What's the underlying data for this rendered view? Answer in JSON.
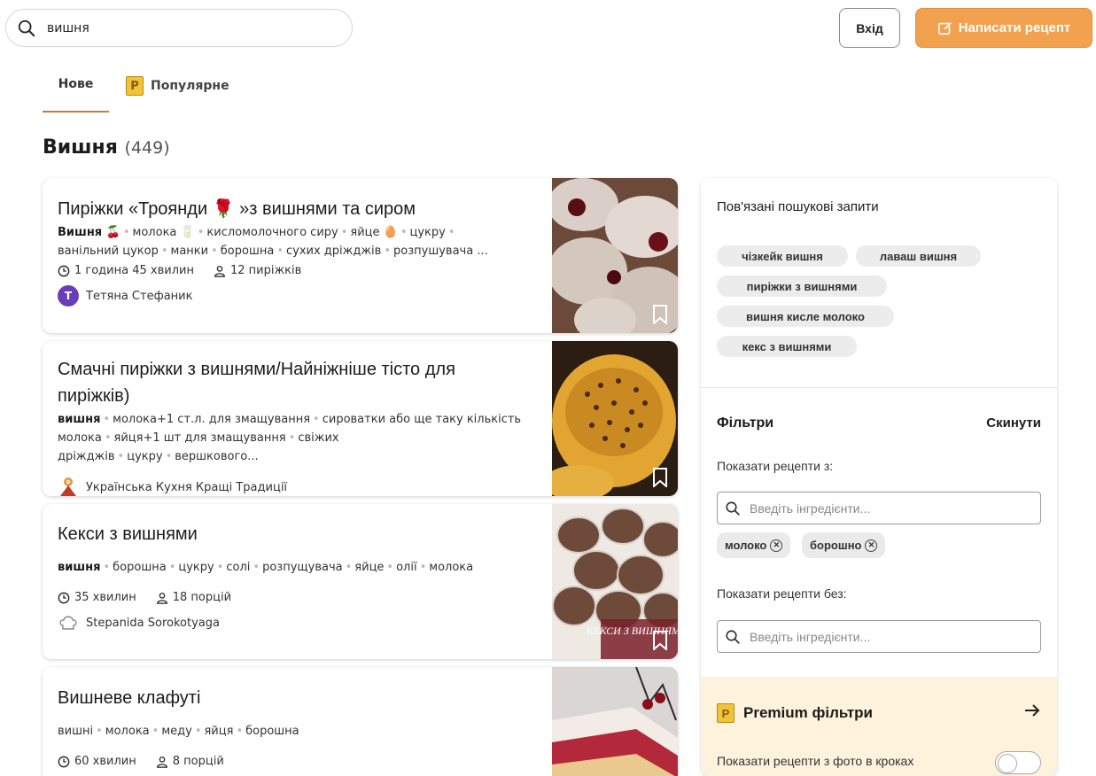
{
  "search": {
    "value": "вишня"
  },
  "header": {
    "login_label": "Вхід",
    "write_label": "Написати рецепт"
  },
  "tabs": [
    {
      "label": "Нове"
    },
    {
      "label": "Популярне"
    }
  ],
  "heading": {
    "title": "Вишня",
    "count": "(449)"
  },
  "recipes": [
    {
      "title": "Пиріжки «Троянди 🌹 »з вишнями та сиром",
      "ingredients_line1": [
        "Вишня 🍒",
        "молока 🥛",
        "кисломолочного сиру",
        "яйце 🥚",
        "цукру"
      ],
      "ingredients_line2": [
        "ванільний цукор",
        "манки",
        "борошна",
        "сухих дріжджів",
        "розпушувача ..."
      ],
      "time": "1 година 45 хвилин",
      "servings": "12 пиріжків",
      "author": "Тетяна Стефаник",
      "author_initial": "T"
    },
    {
      "title": "Смачні пиріжки з вишнями/Найніжніше тісто для пиріжків)",
      "ingredients_line1": [
        "вишня",
        "молока+1 ст.л. для змащування",
        "сироватки або ще таку кількість"
      ],
      "ingredients_line2": [
        "молока",
        "яйця+1 шт для змащування",
        "свіжих дріжджів",
        "цукру",
        "вершкового..."
      ],
      "author": "Українська Кухня Кращі Традиції"
    },
    {
      "title": "Кекси з вишнями",
      "ingredients_line1": [
        "вишня",
        "борошна",
        "цукру",
        "солі",
        "розпущувача",
        "яйце",
        "олії",
        "молока"
      ],
      "time": "35 хвилин",
      "servings": "18 порцій",
      "author": "Stepanida Sorokotyaga",
      "photo_caption": "КЕКСИ З ВИШНЯМИ"
    },
    {
      "title": "Вишневе клафуті",
      "ingredients_line1": [
        "вишні",
        "молока",
        "меду",
        "яйця",
        "борошна"
      ],
      "time": "60 хвилин",
      "servings": "8 порцій"
    }
  ],
  "sidebar": {
    "related_title": "Пов'язані пошукові запити",
    "related": [
      "чізкейк вишня",
      "лаваш вишня",
      "пиріжки з вишнями",
      "вишня кисле молоко",
      "кекс з вишнями"
    ],
    "filters_title": "Фільтри",
    "reset_label": "Скинути",
    "show_with_label": "Показати рецепти з:",
    "show_without_label": "Показати рецепти без:",
    "ingredient_placeholder": "Введіть інгредієнти...",
    "with_tags": [
      "молоко",
      "борошно"
    ],
    "premium_title": "Premium фільтри",
    "photo_steps_label": "Показати рецепти з фото в кроках"
  },
  "colors": {
    "accent": "#f2a14e",
    "tab_underline": "#c87a36",
    "premium_bg": "#fdf3dc"
  }
}
